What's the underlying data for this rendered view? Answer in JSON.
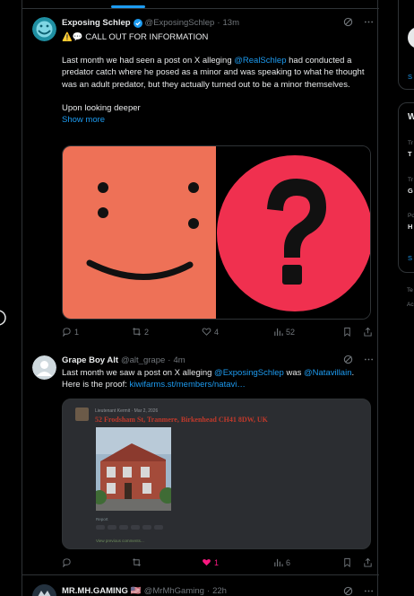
{
  "post1": {
    "name": "Exposing Schlep",
    "handle": "@ExposingSchlep",
    "time": "13m",
    "line1": "⚠️💬 CALL OUT FOR INFORMATION",
    "p_pre": "Last month we had seen a post on X alleging ",
    "p_link": "@RealSchlep",
    "p_post": " had conducted a predator catch where he posed as a minor and was speaking to what he thought was an adult predator, but they actually turned out to be a minor themselves.",
    "p2": "Upon looking deeper",
    "show_more": "Show more",
    "replies": "1",
    "reposts": "2",
    "likes": "4",
    "views": "52"
  },
  "post2": {
    "name": "Grape Boy Alt",
    "handle": "@alt_grape",
    "time": "4m",
    "t1": "Last month we saw a post on X alleging ",
    "t_link1": "@ExposingSchlep",
    "t2": "  was ",
    "t_link2": "@Natavillain",
    "t3": ".",
    "t4": "Here is the proof: ",
    "t_link3": "kiwifarms.st/members/natavi…",
    "likes": "1",
    "views": "6",
    "embed": {
      "user": "Lieutenant Kermit",
      "date": "Mar 2, 2026",
      "address": "52 Frodsham St, Tranmere, Birkenhead CH41 8DW, UK",
      "report": "Report",
      "footer": "View previous comments..."
    }
  },
  "post3": {
    "name": "MR.MH.GAMING",
    "flag": "🇺🇸",
    "handle": "@MrMhGaming",
    "time": "22h"
  },
  "sidebar": {
    "l1": "W",
    "t1": "Tr",
    "b1": "T",
    "t2": "Tr",
    "b2": "G",
    "t3": "Po",
    "b3": "H",
    "s1": "S",
    "s2": "S",
    "f1": "Te",
    "f2": "Ac"
  }
}
